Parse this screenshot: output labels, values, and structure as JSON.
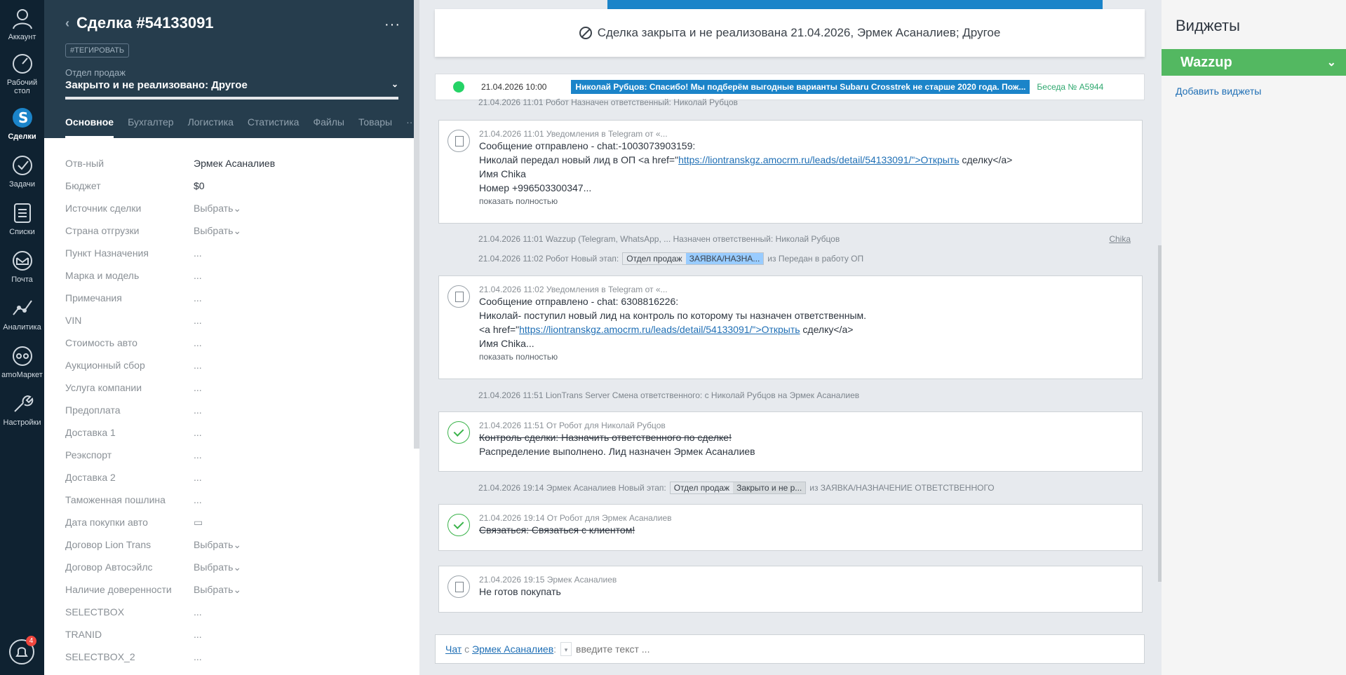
{
  "nav": {
    "account": "Аккаунт",
    "desktop": "Рабочий стол",
    "deals": "Сделки",
    "tasks": "Задачи",
    "lists": "Списки",
    "mail": "Почта",
    "analytics": "Аналитика",
    "market": "amoМаркет",
    "settings": "Настройки",
    "notifications_count": "4"
  },
  "card": {
    "title": "Сделка #54133091",
    "tag_button": "#ТЕГИРОВАТЬ",
    "pipeline_label": "Отдел продаж",
    "pipeline_status": "Закрыто и не реализовано: Другое",
    "tabs": [
      "Основное",
      "Бухгалтер",
      "Логистика",
      "Статистика",
      "Файлы",
      "Товары"
    ],
    "fields": [
      {
        "label": "Отв-ный",
        "value": "Эрмек Асаналиев"
      },
      {
        "label": "Бюджет",
        "value": "$0"
      },
      {
        "label": "Источник сделки",
        "value": "Выбрать"
      },
      {
        "label": "Страна отгрузки",
        "value": "Выбрать"
      },
      {
        "label": "Пункт Назначения",
        "value": "..."
      },
      {
        "label": "Марка и модель",
        "value": "..."
      },
      {
        "label": "Примечания",
        "value": "..."
      },
      {
        "label": "VIN",
        "value": "..."
      },
      {
        "label": "Стоимость авто",
        "value": "..."
      },
      {
        "label": "Аукционный сбор",
        "value": "..."
      },
      {
        "label": "Услуга компании",
        "value": "..."
      },
      {
        "label": "Предоплата",
        "value": "..."
      },
      {
        "label": "Доставка 1",
        "value": "..."
      },
      {
        "label": "Реэкспорт",
        "value": "..."
      },
      {
        "label": "Доставка 2",
        "value": "..."
      },
      {
        "label": "Таможенная пошлина",
        "value": "..."
      },
      {
        "label": "Дата покупки авто",
        "value": "▭"
      },
      {
        "label": "Договор Lion Trans",
        "value": "Выбрать"
      },
      {
        "label": "Договор Автосэйлс",
        "value": "Выбрать"
      },
      {
        "label": "Наличие довереннoсти",
        "value": "Выбрать"
      },
      {
        "label": "SELECTBOX",
        "value": "..."
      },
      {
        "label": "TRANID",
        "value": "..."
      },
      {
        "label": "SELECTBOX_2",
        "value": "..."
      }
    ]
  },
  "feed": {
    "closed_banner": "Сделка закрыта и не реализована 21.04.2026, Эрмек Асаналиев; Другое",
    "wa_time": "21.04.2026 10:00",
    "wa_message": "Николай Рубцов: Спасибо! Мы подберём выгодные варианты Subaru Crosstrek не старше 2020 года. Пож...",
    "wa_chat": "Беседа № A5944",
    "line1": "21.04.2026 11:01 Робот Назначен ответственный: Николай Рубцов",
    "note1_meta": "21.04.2026 11:01 Уведомления в Telegram от «...",
    "note1_l1": "Сообщение отправлено - chat:-1003073903159:",
    "note1_l2a": "Николай передал новый лид в ОП <a href=\"",
    "note1_link": "https://liontranskgz.amocrm.ru/leads/detail/54133091/\">Открыть",
    "note1_l2b": " сделку</a>",
    "note1_l3": "Имя Chika",
    "note1_l4": "Номер +996503300347...",
    "show_full": "показать полностью",
    "line2": "21.04.2026 11:01 Wazzup (Telegram, WhatsApp, ... Назначен ответственный: Николай Рубцов",
    "line2_author": "Chika",
    "line3_prefix": "21.04.2026 11:02 Робот Новый этап:",
    "line3_stage1": "Отдел продаж",
    "line3_stage2": "ЗАЯВКА/НАЗНА...",
    "line3_suffix": "из Передан в работу ОП",
    "note2_meta": "21.04.2026 11:02 Уведомления в Telegram от «...",
    "note2_l1": "Сообщение отправлено - chat: 6308816226:",
    "note2_l2": "Николай- поступил новый лид на контроль по которому ты назначен ответственным.",
    "note2_l3a": "<a href=\"",
    "note2_link": "https://liontranskgz.amocrm.ru/leads/detail/54133091/\">Открыть",
    "note2_l3b": " сделку</a>",
    "note2_l4": "Имя Chika...",
    "line4": "21.04.2026 11:51 LionTrans Server Смена ответственного: с Николай Рубцов на Эрмек Асаналиев",
    "task1_meta": "21.04.2026 11:51  От Робот для Николай Рубцов",
    "task1_l1": "Контроль сделки: Назначить ответственного по сделке!",
    "task1_l2": "Распределение выполнено. Лид назначен Эрмек Асаналиев",
    "line5_prefix": "21.04.2026 19:14 Эрмек Асаналиев Новый этап:",
    "line5_stage1": "Отдел продаж",
    "line5_stage2": "Закрыто и не р...",
    "line5_suffix": "из ЗАЯВКА/НАЗНАЧЕНИЕ ОТВЕТСТВЕННОГО",
    "task2_meta": "21.04.2026 19:14  От Робот для Эрмек Асаналиев",
    "task2_l1": "Связаться: Связаться с клиентом!",
    "note3_meta": "21.04.2026 19:15 Эрмек Асаналиев",
    "note3_l1": "Не готов покупать",
    "chat_label": "Чат",
    "chat_with": "с",
    "chat_user": "Эрмек Асаналиев",
    "chat_placeholder": "введите текст ..."
  },
  "widgets": {
    "title": "Виджеты",
    "wazzup": "Wazzup",
    "add": "Добавить виджеты"
  },
  "colors": {
    "nav_bg": "#0f2231",
    "card_head": "#263d4d",
    "accent_blue": "#1b84c9",
    "wazzup_green": "#53b861"
  }
}
